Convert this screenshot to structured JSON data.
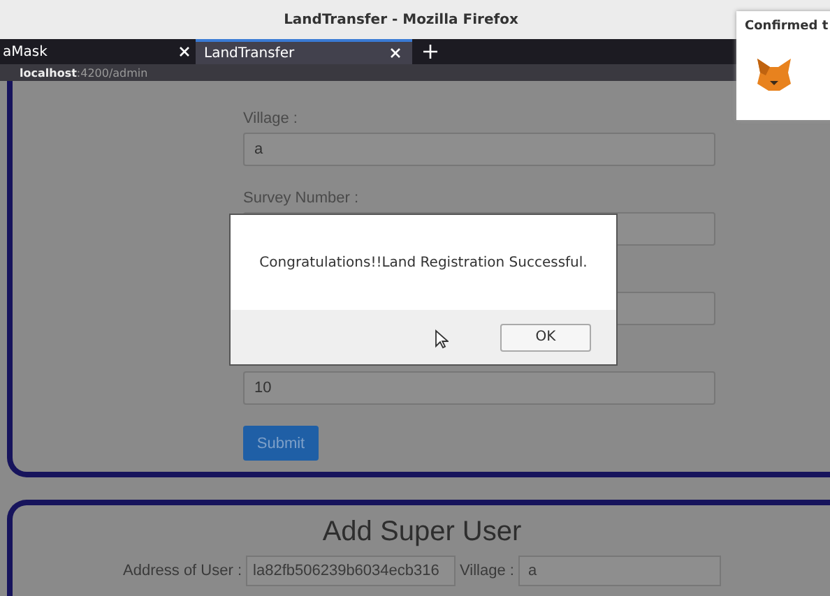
{
  "window": {
    "title": "LandTransfer - Mozilla Firefox"
  },
  "tabs": [
    {
      "label": "aMask",
      "selected": false
    },
    {
      "label": "LandTransfer",
      "selected": true
    }
  ],
  "address_bar": {
    "host": "localhost",
    "path": ":4200/admin"
  },
  "form": {
    "fields": [
      {
        "kind": "text",
        "label": "Village :",
        "value": "a"
      },
      {
        "kind": "text",
        "label": "Survey Number :"
      },
      {
        "kind": "text"
      },
      {
        "kind": "text",
        "value": "10"
      }
    ],
    "submit": "Submit"
  },
  "super_user": {
    "title": "Add Super User",
    "fields": [
      {
        "label": "Address of User :",
        "value": "la82fb506239b6034ecb316"
      },
      {
        "label": "Village :",
        "value": "a"
      }
    ]
  },
  "dialog": {
    "message": "Congratulations!!Land Registration Successful.",
    "button": "OK"
  },
  "notification": {
    "title": "Confirmed t"
  }
}
